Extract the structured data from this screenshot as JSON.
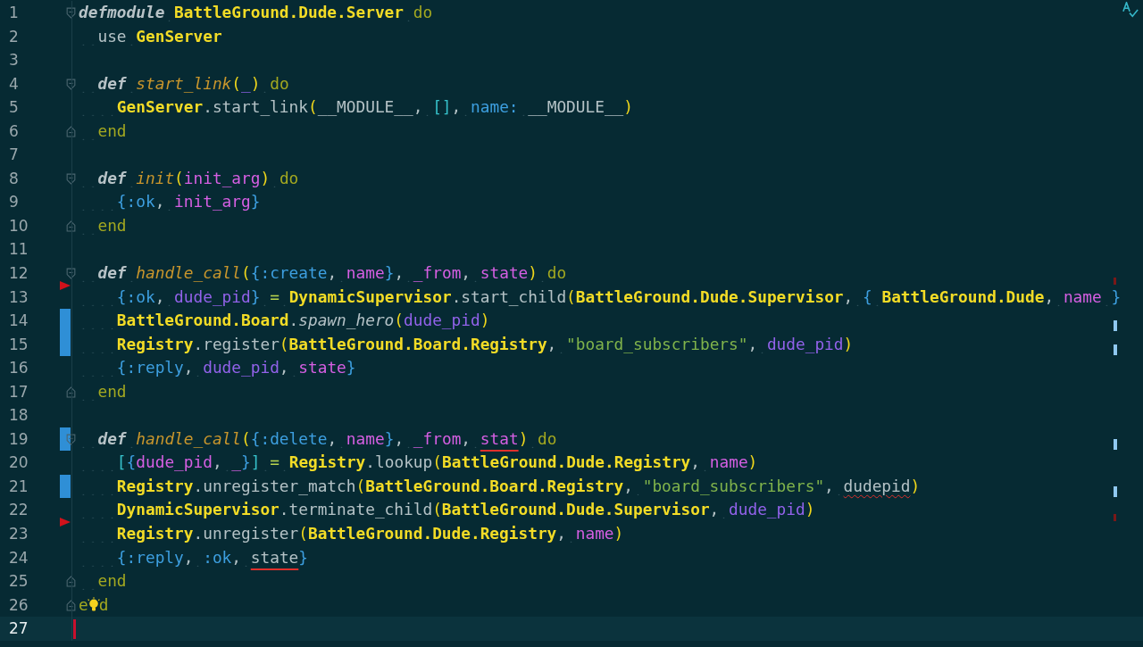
{
  "lines": [
    {
      "number": "1",
      "fold_start": true,
      "tokens": [
        {
          "kind": "kw",
          "text": "defmodule "
        },
        {
          "kind": "mod",
          "text": "BattleGround.Dude.Server"
        },
        {
          "kind": "do",
          "text": " do"
        }
      ]
    },
    {
      "number": "2",
      "tokens": [
        {
          "kind": "plain",
          "text": "  use "
        },
        {
          "kind": "mod",
          "text": "GenServer"
        }
      ]
    },
    {
      "number": "3"
    },
    {
      "number": "4",
      "fold_start": true,
      "tokens": [
        {
          "kind": "kw",
          "text": "  def "
        },
        {
          "kind": "fn",
          "text": "start_link"
        },
        {
          "kind": "paren",
          "text": "("
        },
        {
          "kind": "pid",
          "text": "_"
        },
        {
          "kind": "paren",
          "text": ")"
        },
        {
          "kind": "do",
          "text": " do"
        }
      ]
    },
    {
      "number": "5",
      "tokens": [
        {
          "kind": "mod",
          "text": "    GenServer"
        },
        {
          "kind": "plain",
          "text": ".start_link"
        },
        {
          "kind": "paren",
          "text": "("
        },
        {
          "kind": "plain",
          "text": "__MODULE__, "
        },
        {
          "kind": "list",
          "text": "[]"
        },
        {
          "kind": "plain",
          "text": ", "
        },
        {
          "kind": "atom",
          "text": "name: "
        },
        {
          "kind": "plain",
          "text": "__MODULE__"
        },
        {
          "kind": "paren",
          "text": ")"
        }
      ]
    },
    {
      "number": "6",
      "fold_end": true,
      "tokens": [
        {
          "kind": "do",
          "text": "  end"
        }
      ]
    },
    {
      "number": "7"
    },
    {
      "number": "8",
      "fold_start": true,
      "tokens": [
        {
          "kind": "kw",
          "text": "  def "
        },
        {
          "kind": "fn",
          "text": "init"
        },
        {
          "kind": "paren",
          "text": "("
        },
        {
          "kind": "var",
          "text": "init_arg"
        },
        {
          "kind": "paren",
          "text": ")"
        },
        {
          "kind": "do",
          "text": " do"
        }
      ]
    },
    {
      "number": "9",
      "tokens": [
        {
          "kind": "atom",
          "text": "    {:ok"
        },
        {
          "kind": "plain",
          "text": ", "
        },
        {
          "kind": "var",
          "text": "init_arg"
        },
        {
          "kind": "atom",
          "text": "}"
        }
      ]
    },
    {
      "number": "10",
      "fold_end": true,
      "tokens": [
        {
          "kind": "do",
          "text": "  end"
        }
      ]
    },
    {
      "number": "11"
    },
    {
      "number": "12",
      "fold_start": true,
      "tokens": [
        {
          "kind": "kw",
          "text": "  def "
        },
        {
          "kind": "fn",
          "text": "handle_call"
        },
        {
          "kind": "paren",
          "text": "("
        },
        {
          "kind": "atom",
          "text": "{:create"
        },
        {
          "kind": "plain",
          "text": ", "
        },
        {
          "kind": "var",
          "text": "name"
        },
        {
          "kind": "atom",
          "text": "}"
        },
        {
          "kind": "plain",
          "text": ", "
        },
        {
          "kind": "var",
          "text": "_from"
        },
        {
          "kind": "plain",
          "text": ", "
        },
        {
          "kind": "var",
          "text": "state"
        },
        {
          "kind": "paren",
          "text": ")"
        },
        {
          "kind": "do",
          "text": " do"
        }
      ]
    },
    {
      "number": "13",
      "deleted": true,
      "tokens": [
        {
          "kind": "atom",
          "text": "    {:ok"
        },
        {
          "kind": "plain",
          "text": ", "
        },
        {
          "kind": "pid",
          "text": "dude_pid"
        },
        {
          "kind": "atom",
          "text": "}"
        },
        {
          "kind": "op",
          "text": " = "
        },
        {
          "kind": "mod",
          "text": "DynamicSupervisor"
        },
        {
          "kind": "plain",
          "text": ".start_child"
        },
        {
          "kind": "paren",
          "text": "("
        },
        {
          "kind": "mod",
          "text": "BattleGround.Dude.Supervisor"
        },
        {
          "kind": "plain",
          "text": ", "
        },
        {
          "kind": "atom",
          "text": "{ "
        },
        {
          "kind": "mod",
          "text": "BattleGround.Dude"
        },
        {
          "kind": "plain",
          "text": ", "
        },
        {
          "kind": "var",
          "text": "name"
        },
        {
          "kind": "atom",
          "text": " }"
        }
      ]
    },
    {
      "number": "14",
      "modified": true,
      "tokens": [
        {
          "kind": "mod",
          "text": "    BattleGround.Board"
        },
        {
          "kind": "plain",
          "text": "."
        },
        {
          "kind": "call",
          "text": "spawn_hero"
        },
        {
          "kind": "paren",
          "text": "("
        },
        {
          "kind": "pid",
          "text": "dude_pid"
        },
        {
          "kind": "paren",
          "text": ")"
        }
      ]
    },
    {
      "number": "15",
      "modified": true,
      "tokens": [
        {
          "kind": "mod",
          "text": "    Registry"
        },
        {
          "kind": "plain",
          "text": ".register"
        },
        {
          "kind": "paren",
          "text": "("
        },
        {
          "kind": "mod",
          "text": "BattleGround.Board.Registry"
        },
        {
          "kind": "plain",
          "text": ", "
        },
        {
          "kind": "str",
          "text": "\"board_subscribers\""
        },
        {
          "kind": "plain",
          "text": ", "
        },
        {
          "kind": "pid",
          "text": "dude_pid"
        },
        {
          "kind": "paren",
          "text": ")"
        }
      ]
    },
    {
      "number": "16",
      "tokens": [
        {
          "kind": "atom",
          "text": "    {:reply"
        },
        {
          "kind": "plain",
          "text": ", "
        },
        {
          "kind": "pid",
          "text": "dude_pid"
        },
        {
          "kind": "plain",
          "text": ", "
        },
        {
          "kind": "var",
          "text": "state"
        },
        {
          "kind": "atom",
          "text": "}"
        }
      ]
    },
    {
      "number": "17",
      "fold_end": true,
      "tokens": [
        {
          "kind": "do",
          "text": "  end"
        }
      ]
    },
    {
      "number": "18"
    },
    {
      "number": "19",
      "fold_start": true,
      "modified": true,
      "tokens": [
        {
          "kind": "kw",
          "text": "  def "
        },
        {
          "kind": "fn",
          "text": "handle_call"
        },
        {
          "kind": "paren",
          "text": "("
        },
        {
          "kind": "atom",
          "text": "{:delete"
        },
        {
          "kind": "plain",
          "text": ", "
        },
        {
          "kind": "var",
          "text": "name"
        },
        {
          "kind": "atom",
          "text": "}"
        },
        {
          "kind": "plain",
          "text": ", "
        },
        {
          "kind": "var",
          "text": "_from"
        },
        {
          "kind": "plain",
          "text": ", "
        },
        {
          "kind": "var",
          "text": "stat",
          "error": true
        },
        {
          "kind": "paren",
          "text": ")"
        },
        {
          "kind": "do",
          "text": " do"
        }
      ]
    },
    {
      "number": "20",
      "tokens": [
        {
          "kind": "list",
          "text": "    ["
        },
        {
          "kind": "atom",
          "text": "{"
        },
        {
          "kind": "var",
          "text": "dude_pid"
        },
        {
          "kind": "plain",
          "text": ", "
        },
        {
          "kind": "var",
          "text": "_"
        },
        {
          "kind": "atom",
          "text": "}"
        },
        {
          "kind": "list",
          "text": "]"
        },
        {
          "kind": "op",
          "text": " = "
        },
        {
          "kind": "mod",
          "text": "Registry"
        },
        {
          "kind": "plain",
          "text": ".lookup"
        },
        {
          "kind": "paren",
          "text": "("
        },
        {
          "kind": "mod",
          "text": "BattleGround.Dude.Registry"
        },
        {
          "kind": "plain",
          "text": ", "
        },
        {
          "kind": "var",
          "text": "name"
        },
        {
          "kind": "paren",
          "text": ")"
        }
      ]
    },
    {
      "number": "21",
      "modified": true,
      "tokens": [
        {
          "kind": "mod",
          "text": "    Registry"
        },
        {
          "kind": "plain",
          "text": ".unregister_match"
        },
        {
          "kind": "paren",
          "text": "("
        },
        {
          "kind": "mod",
          "text": "BattleGround.Board.Registry"
        },
        {
          "kind": "plain",
          "text": ", "
        },
        {
          "kind": "str",
          "text": "\"board_subscribers\""
        },
        {
          "kind": "plain",
          "text": ", "
        },
        {
          "kind": "plain",
          "text": "dudepid",
          "error": true,
          "misspelled": true
        },
        {
          "kind": "paren",
          "text": ")"
        }
      ]
    },
    {
      "number": "22",
      "tokens": [
        {
          "kind": "mod",
          "text": "    DynamicSupervisor"
        },
        {
          "kind": "plain",
          "text": ".terminate_child"
        },
        {
          "kind": "paren",
          "text": "("
        },
        {
          "kind": "mod",
          "text": "BattleGround.Dude.Supervisor"
        },
        {
          "kind": "plain",
          "text": ", "
        },
        {
          "kind": "pid",
          "text": "dude_pid"
        },
        {
          "kind": "paren",
          "text": ")"
        }
      ]
    },
    {
      "number": "23",
      "deleted": true,
      "tokens": [
        {
          "kind": "mod",
          "text": "    Registry"
        },
        {
          "kind": "plain",
          "text": ".unregister"
        },
        {
          "kind": "paren",
          "text": "("
        },
        {
          "kind": "mod",
          "text": "BattleGround.Dude.Registry"
        },
        {
          "kind": "plain",
          "text": ", "
        },
        {
          "kind": "var",
          "text": "name"
        },
        {
          "kind": "paren",
          "text": ")"
        }
      ]
    },
    {
      "number": "24",
      "tokens": [
        {
          "kind": "atom",
          "text": "    {:reply"
        },
        {
          "kind": "plain",
          "text": ", "
        },
        {
          "kind": "atom",
          "text": ":ok"
        },
        {
          "kind": "plain",
          "text": ", "
        },
        {
          "kind": "plain",
          "text": "state",
          "error": true
        },
        {
          "kind": "atom",
          "text": "}"
        }
      ]
    },
    {
      "number": "25",
      "fold_end": true,
      "tokens": [
        {
          "kind": "do",
          "text": "  end"
        }
      ]
    },
    {
      "number": "26",
      "fold_end": true,
      "lightbulb": true,
      "tokens": [
        {
          "kind": "do",
          "text": "e"
        },
        {
          "kind": "do",
          "text": "d"
        }
      ]
    },
    {
      "number": "27",
      "current": true
    }
  ]
}
